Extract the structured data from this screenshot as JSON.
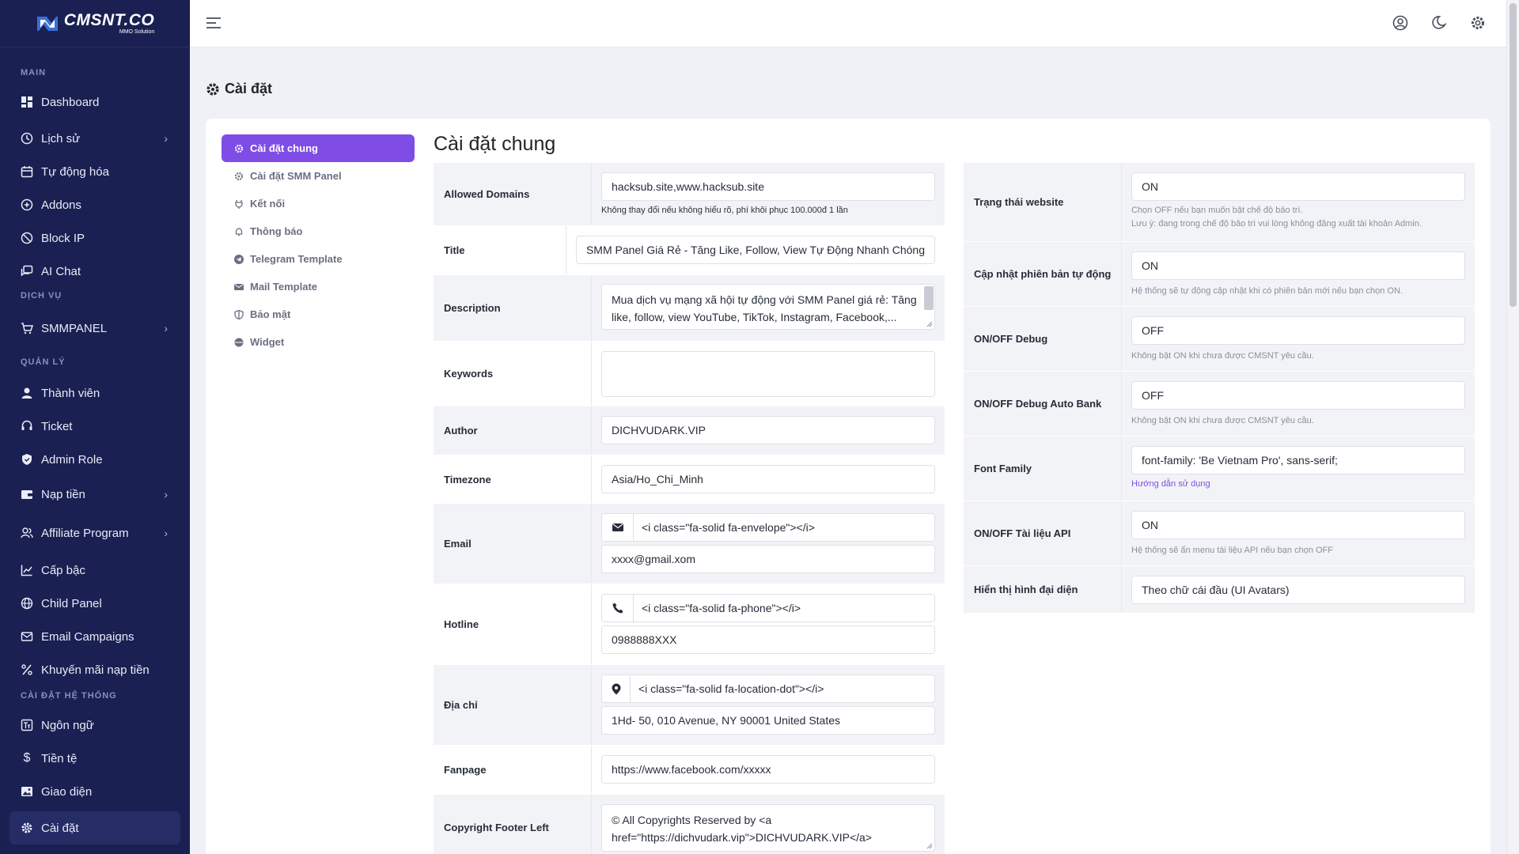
{
  "brand": {
    "logo_main": "CMSNT.CO",
    "logo_sub": "MMO Solution"
  },
  "sidebar": {
    "sections": [
      "MAIN",
      "DỊCH VỤ",
      "QUẢN LÝ",
      "CÀI ĐẶT HỆ THỐNG"
    ],
    "items": [
      {
        "label": "Dashboard"
      },
      {
        "label": "Lịch sử"
      },
      {
        "label": "Tự động hóa"
      },
      {
        "label": "Addons"
      },
      {
        "label": "Block IP"
      },
      {
        "label": "AI Chat"
      },
      {
        "label": "SMMPANEL"
      },
      {
        "label": "Thành viên"
      },
      {
        "label": "Ticket"
      },
      {
        "label": "Admin Role"
      },
      {
        "label": "Nạp tiền"
      },
      {
        "label": "Affiliate Program"
      },
      {
        "label": "Cấp bậc"
      },
      {
        "label": "Child Panel"
      },
      {
        "label": "Email Campaigns"
      },
      {
        "label": "Khuyến mãi nạp tiền"
      },
      {
        "label": "Ngôn ngữ"
      },
      {
        "label": "Tiền tệ"
      },
      {
        "label": "Giao diện"
      },
      {
        "label": "Cài đặt"
      }
    ]
  },
  "page": {
    "title": "Cài đặt"
  },
  "subnav": {
    "items": [
      {
        "label": "Cài đặt chung"
      },
      {
        "label": "Cài đặt SMM Panel"
      },
      {
        "label": "Kết nối"
      },
      {
        "label": "Thông báo"
      },
      {
        "label": "Telegram Template"
      },
      {
        "label": "Mail Template"
      },
      {
        "label": "Bảo mật"
      },
      {
        "label": "Widget"
      }
    ]
  },
  "general": {
    "heading": "Cài đặt chung",
    "allowed_domains": {
      "label": "Allowed Domains",
      "value": "hacksub.site,www.hacksub.site",
      "hint": "Không thay đổi nếu không hiểu rõ, phí khôi phục 100.000đ 1 lần"
    },
    "title": {
      "label": "Title",
      "value": "SMM Panel Giá Rẻ - Tăng Like, Follow, View Tự Động Nhanh Chóng"
    },
    "description": {
      "label": "Description",
      "line1": "Mua dịch vụ mạng xã hội tự động với SMM Panel giá rẻ: Tăng",
      "line2": "like, follow, view YouTube, TikTok, Instagram, Facebook,..."
    },
    "keywords": {
      "label": "Keywords",
      "value": ""
    },
    "author": {
      "label": "Author",
      "value": "DICHVUDARK.VIP"
    },
    "timezone": {
      "label": "Timezone",
      "value": "Asia/Ho_Chi_Minh"
    },
    "email": {
      "label": "Email",
      "icon_value": "<i class=\"fa-solid fa-envelope\"></i>",
      "value": "xxxx@gmail.xom"
    },
    "hotline": {
      "label": "Hotline",
      "icon_value": "<i class=\"fa-solid fa-phone\"></i>",
      "value": "0988888XXX"
    },
    "address": {
      "label": "Địa chỉ",
      "icon_value": "<i class=\"fa-solid fa-location-dot\"></i>",
      "value": "1Hd- 50, 010 Avenue, NY 90001 United States"
    },
    "fanpage": {
      "label": "Fanpage",
      "value": "https://www.facebook.com/xxxxx"
    },
    "copyright_left": {
      "label": "Copyright Footer Left",
      "line1": "© All Copyrights Reserved by <a",
      "line2": "href=\"https://dichvudark.vip\">DICHVUDARK.VIP</a>"
    }
  },
  "right": {
    "status": {
      "label": "Trạng thái website",
      "value": "ON",
      "hint1": "Chọn OFF nếu bạn muốn bật chế độ bảo trì.",
      "hint2": "Lưu ý: đang trong chế độ bảo trì vui lòng không đăng xuất tài khoản Admin."
    },
    "auto_update": {
      "label": "Cập nhật phiên bản tự động",
      "value": "ON",
      "hint": "Hệ thống sẽ tự động cập nhật khi có phiên bản mới nếu bạn chọn ON."
    },
    "debug": {
      "label": "ON/OFF Debug",
      "value": "OFF",
      "hint": "Không bật ON khi chưa được CMSNT yêu cầu."
    },
    "debug_bank": {
      "label": "ON/OFF Debug Auto Bank",
      "value": "OFF",
      "hint": "Không bật ON khi chưa được CMSNT yêu cầu."
    },
    "font_family": {
      "label": "Font Family",
      "value": "font-family: 'Be Vietnam Pro', sans-serif;",
      "link": "Hướng dẫn sử dụng"
    },
    "api_docs": {
      "label": "ON/OFF Tài liệu API",
      "value": "ON",
      "hint": "Hệ thống sẽ ẩn menu tài liệu API nếu bạn chọn OFF"
    },
    "avatar_display": {
      "label": "Hiển thị hình đại diện",
      "value": "Theo chữ cái đầu (UI Avatars)"
    }
  },
  "colors": {
    "sidebar_bg": "#1a2052",
    "accent": "#7f4de6",
    "page_bg": "#f0f1f7"
  }
}
